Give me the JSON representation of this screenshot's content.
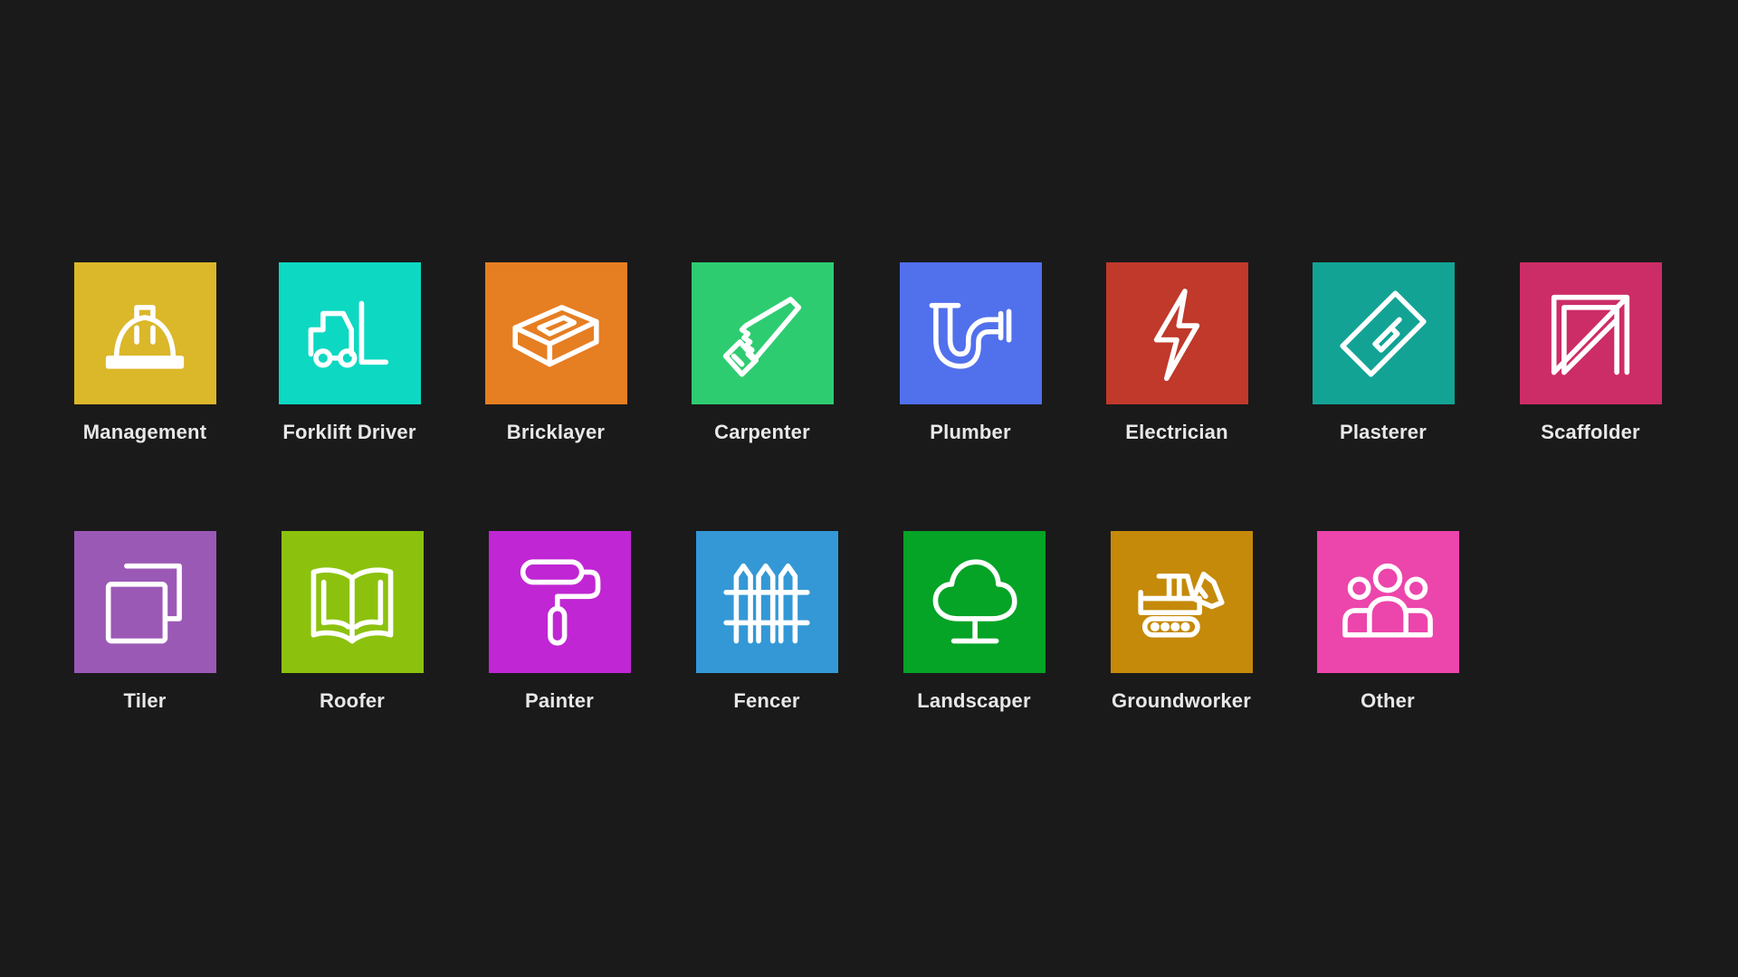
{
  "trades": [
    {
      "label": "Management",
      "color": "#dbb72a",
      "icon": "hard-hat-icon"
    },
    {
      "label": "Forklift Driver",
      "color": "#0dd8c2",
      "icon": "forklift-icon"
    },
    {
      "label": "Bricklayer",
      "color": "#e67e22",
      "icon": "brick-icon"
    },
    {
      "label": "Carpenter",
      "color": "#2ecc71",
      "icon": "saw-icon"
    },
    {
      "label": "Plumber",
      "color": "#5170ec",
      "icon": "pipe-icon"
    },
    {
      "label": "Electrician",
      "color": "#c0392b",
      "icon": "lightning-bolt-icon"
    },
    {
      "label": "Plasterer",
      "color": "#13a394",
      "icon": "trowel-icon"
    },
    {
      "label": "Scaffolder",
      "color": "#cc2d66",
      "icon": "scaffold-icon"
    },
    {
      "label": "Tiler",
      "color": "#9b59b6",
      "icon": "tiles-icon"
    },
    {
      "label": "Roofer",
      "color": "#8cc20e",
      "icon": "open-book-icon"
    },
    {
      "label": "Painter",
      "color": "#c026d3",
      "icon": "paint-roller-icon"
    },
    {
      "label": "Fencer",
      "color": "#3498d6",
      "icon": "fence-icon"
    },
    {
      "label": "Landscaper",
      "color": "#05a326",
      "icon": "tree-icon"
    },
    {
      "label": "Groundworker",
      "color": "#c58a0a",
      "icon": "excavator-icon"
    },
    {
      "label": "Other",
      "color": "#ec45ab",
      "icon": "people-group-icon"
    }
  ]
}
